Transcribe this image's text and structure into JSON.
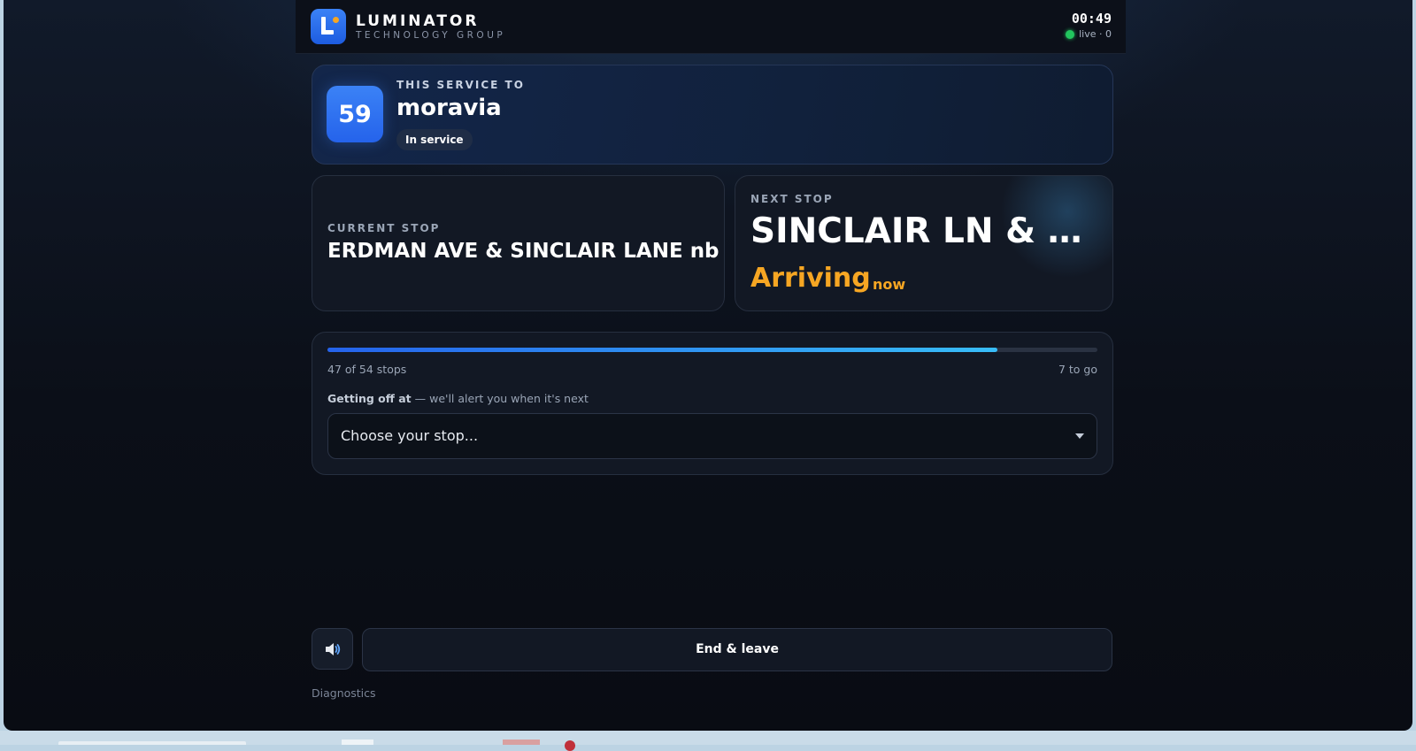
{
  "header": {
    "brand_name": "LUMINATOR",
    "brand_sub": "TECHNOLOGY GROUP",
    "clock": "00:49",
    "live_status": "live · 0"
  },
  "service": {
    "route_number": "59",
    "label": "THIS SERVICE TO",
    "destination": "moravia",
    "status": "In service"
  },
  "current_stop": {
    "label": "CURRENT STOP",
    "name": "ERDMAN AVE & SINCLAIR LANE nb"
  },
  "next_stop": {
    "label": "NEXT STOP",
    "name": "SINCLAIR LN & C...",
    "eta_main": "Arriving",
    "eta_sub": "now"
  },
  "progress": {
    "current": 47,
    "total": 54,
    "stops_text": "47 of 54 stops",
    "remaining_text": "7 to go"
  },
  "alight": {
    "label_bold": "Getting off at",
    "label_rest": " — we'll alert you when it's next",
    "placeholder": "Choose your stop..."
  },
  "actions": {
    "end_label": "End & leave",
    "diagnostics_label": "Diagnostics"
  },
  "icons": {
    "sound": "speaker-icon",
    "dropdown": "chevron-down-icon"
  },
  "colors": {
    "accent": "#3b82f6",
    "arriving": "#f6a623",
    "live": "#22c55e"
  }
}
